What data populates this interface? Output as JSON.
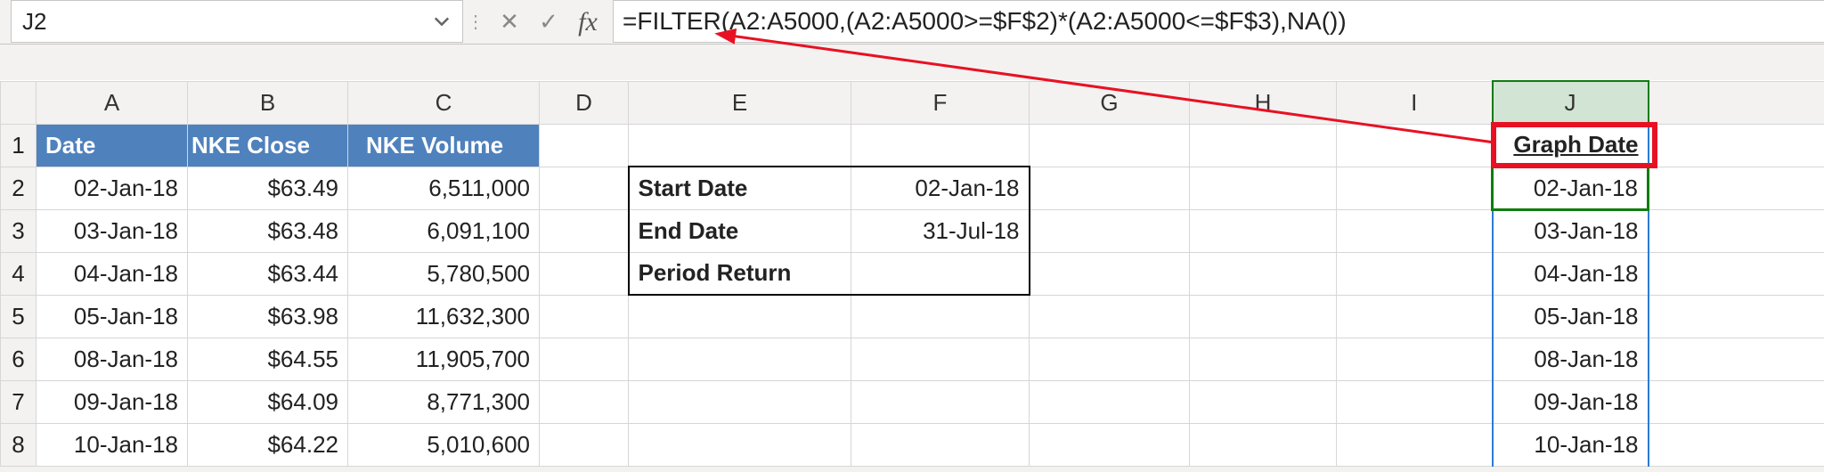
{
  "name_box": {
    "value": "J2"
  },
  "formula_bar": {
    "cancel_icon": "✕",
    "confirm_icon": "✓",
    "fx_label": "fx",
    "formula": "=FILTER(A2:A5000,(A2:A5000>=$F$2)*(A2:A5000<=$F$3),NA())"
  },
  "columns": [
    "A",
    "B",
    "C",
    "D",
    "E",
    "F",
    "G",
    "H",
    "I",
    "J"
  ],
  "row_numbers": [
    "1",
    "2",
    "3",
    "4",
    "5",
    "6",
    "7",
    "8"
  ],
  "headers_row1": {
    "A": "Date",
    "B": "NKE Close",
    "C": "NKE Volume",
    "J": "Graph Date"
  },
  "data_rows": [
    {
      "A": "02-Jan-18",
      "B": "$63.49",
      "C": "6,511,000",
      "J": "02-Jan-18"
    },
    {
      "A": "03-Jan-18",
      "B": "$63.48",
      "C": "6,091,100",
      "J": "03-Jan-18"
    },
    {
      "A": "04-Jan-18",
      "B": "$63.44",
      "C": "5,780,500",
      "J": "04-Jan-18"
    },
    {
      "A": "05-Jan-18",
      "B": "$63.98",
      "C": "11,632,300",
      "J": "05-Jan-18"
    },
    {
      "A": "08-Jan-18",
      "B": "$64.55",
      "C": "11,905,700",
      "J": "08-Jan-18"
    },
    {
      "A": "09-Jan-18",
      "B": "$64.09",
      "C": "8,771,300",
      "J": "09-Jan-18"
    },
    {
      "A": "10-Jan-18",
      "B": "$64.22",
      "C": "5,010,600",
      "J": "10-Jan-18"
    }
  ],
  "params": {
    "start_label": "Start Date",
    "start_value": "02-Jan-18",
    "end_label": "End Date",
    "end_value": "31-Jul-18",
    "return_label": "Period Return",
    "return_value": ""
  },
  "chart_data": {
    "type": "table",
    "title": "NKE price and volume (raw data)",
    "columns": [
      "Date",
      "NKE Close",
      "NKE Volume"
    ],
    "rows": [
      [
        "02-Jan-18",
        63.49,
        6511000
      ],
      [
        "03-Jan-18",
        63.48,
        6091100
      ],
      [
        "04-Jan-18",
        63.44,
        5780500
      ],
      [
        "05-Jan-18",
        63.98,
        11632300
      ],
      [
        "08-Jan-18",
        64.55,
        11905700
      ],
      [
        "09-Jan-18",
        64.09,
        8771300
      ],
      [
        "10-Jan-18",
        64.22,
        5010600
      ]
    ],
    "params": {
      "start_date": "02-Jan-18",
      "end_date": "31-Jul-18"
    }
  }
}
